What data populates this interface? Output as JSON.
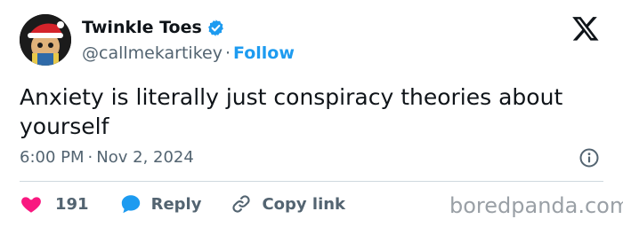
{
  "author": {
    "display_name": "Twinkle Toes",
    "handle": "@callmekartikey",
    "separator": "·",
    "follow_label": "Follow",
    "avatar_icon": "santa-hat-avatar",
    "verified_icon": "verified-badge-icon"
  },
  "tweet": {
    "text": "Anxiety is literally just conspiracy theories about yourself",
    "time": "6:00 PM",
    "separator": "·",
    "date": "Nov 2, 2024"
  },
  "actions": {
    "like_count": "191",
    "reply_label": "Reply",
    "copy_link_label": "Copy link"
  },
  "watermark": "boredpanda.com",
  "colors": {
    "accent": "#1d9bf0",
    "like": "#f91880",
    "muted": "#536471",
    "text": "#0f1419"
  }
}
